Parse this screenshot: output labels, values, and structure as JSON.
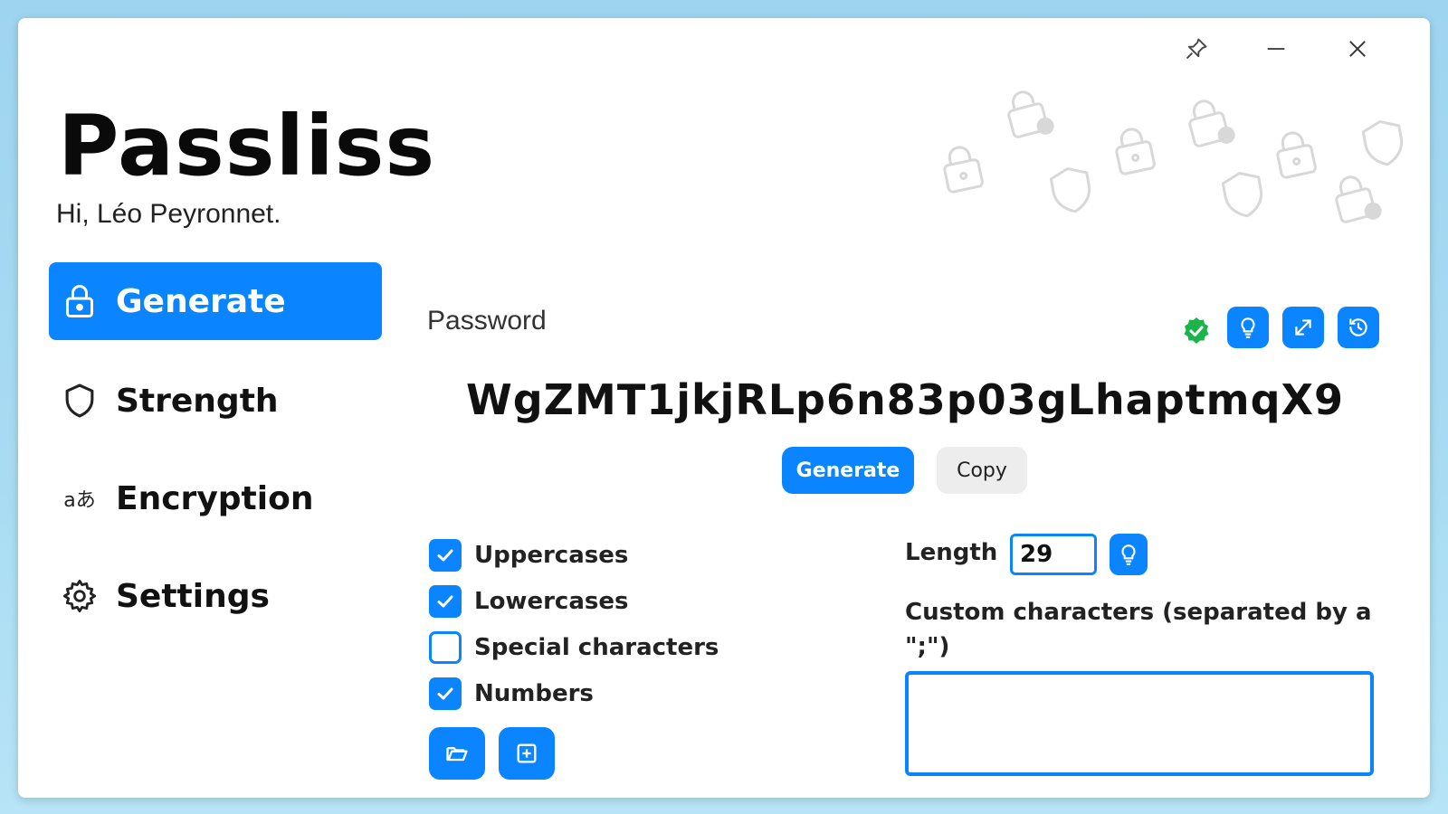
{
  "app": {
    "title": "Passliss",
    "greeting": "Hi, Léo Peyronnet."
  },
  "window_controls": {
    "pin_icon": "pin-icon",
    "minimize_icon": "minimize-icon",
    "close_icon": "close-icon"
  },
  "sidebar": {
    "items": [
      {
        "label": "Generate",
        "icon": "lock-icon",
        "active": true
      },
      {
        "label": "Strength",
        "icon": "shield-icon",
        "active": false
      },
      {
        "label": "Encryption",
        "icon": "translate-icon",
        "active": false
      },
      {
        "label": "Settings",
        "icon": "gear-icon",
        "active": false
      }
    ]
  },
  "generator": {
    "password_label": "Password",
    "password": "WgZMT1jkjRLp6n83p03gLhaptmqX9",
    "generate_label": "Generate",
    "copy_label": "Copy",
    "header_icons": [
      "strength-check-icon",
      "lightbulb-icon",
      "expand-icon",
      "history-icon"
    ]
  },
  "options": {
    "uppercases": {
      "label": "Uppercases",
      "checked": true
    },
    "lowercases": {
      "label": "Lowercases",
      "checked": true
    },
    "special": {
      "label": "Special characters",
      "checked": false
    },
    "numbers": {
      "label": "Numbers",
      "checked": true
    },
    "length_label": "Length",
    "length_value": "29",
    "custom_label": "Custom characters (separated by a \";\")",
    "custom_value": ""
  },
  "colors": {
    "accent": "#0a84ff",
    "success": "#1cb34a",
    "background": "#a9dcf3"
  }
}
